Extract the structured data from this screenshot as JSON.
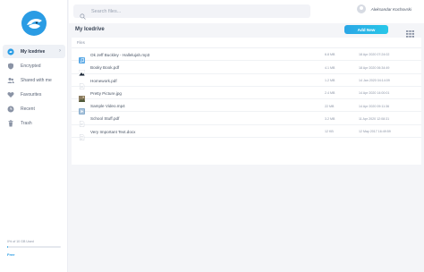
{
  "sidebar": {
    "items": [
      {
        "label": "My Icedrive",
        "icon": "home-icon",
        "active": true
      },
      {
        "label": "Encrypted",
        "icon": "shield-icon",
        "active": false
      },
      {
        "label": "Shared with me",
        "icon": "users-icon",
        "active": false
      },
      {
        "label": "Favourites",
        "icon": "heart-icon",
        "active": false
      },
      {
        "label": "Recent",
        "icon": "clock-icon",
        "active": false
      },
      {
        "label": "Trash",
        "icon": "trash-icon",
        "active": false
      }
    ],
    "chevron": "›",
    "storage": {
      "text": "0% of 10 GB Used",
      "fraction_used": 0.01,
      "plan": "Free"
    }
  },
  "topbar": {
    "search_placeholder": "Search files...",
    "user_name": "Aleksandar Kochovski"
  },
  "main": {
    "title": "My Icedrive",
    "add_label": "Add New",
    "section_label": "Files",
    "files": [
      {
        "name": "Ok Jeff Buckley - Hallelujah.mp3",
        "size": "6.8 MB",
        "date": "18 Apr 2020 07:24:02",
        "icon": "audio-file-icon"
      },
      {
        "name": "Booky Book.pdf",
        "size": "4.1 MB",
        "date": "18 Apr 2020 06:34:49",
        "icon": "pdf-file-icon"
      },
      {
        "name": "Homework.pdf",
        "size": "1.2 MB",
        "date": "14 Jan 2020 04:14:09",
        "icon": "document-file-icon"
      },
      {
        "name": "Pretty Picture.jpg",
        "size": "2.4 MB",
        "date": "14 Apr 2020 14:00:01",
        "icon": "image-file-icon"
      },
      {
        "name": "Sample Video.mp4",
        "size": "22 MB",
        "date": "14 Apr 2020 09:11:36",
        "icon": "video-file-icon"
      },
      {
        "name": "School Stuff.pdf",
        "size": "3.2 MB",
        "date": "11 Apr 2020 12:08:31",
        "icon": "pdf-file-icon"
      },
      {
        "name": "Very Important Text.docx",
        "size": "12 KB",
        "date": "12 May 2017 16:49:59",
        "icon": "text-file-icon"
      }
    ]
  },
  "colors": {
    "accent": "#2a9ce4",
    "accent_light": "#28c7e8",
    "sidebar_bg": "#ffffff",
    "page_bg": "#f4f5f8"
  }
}
